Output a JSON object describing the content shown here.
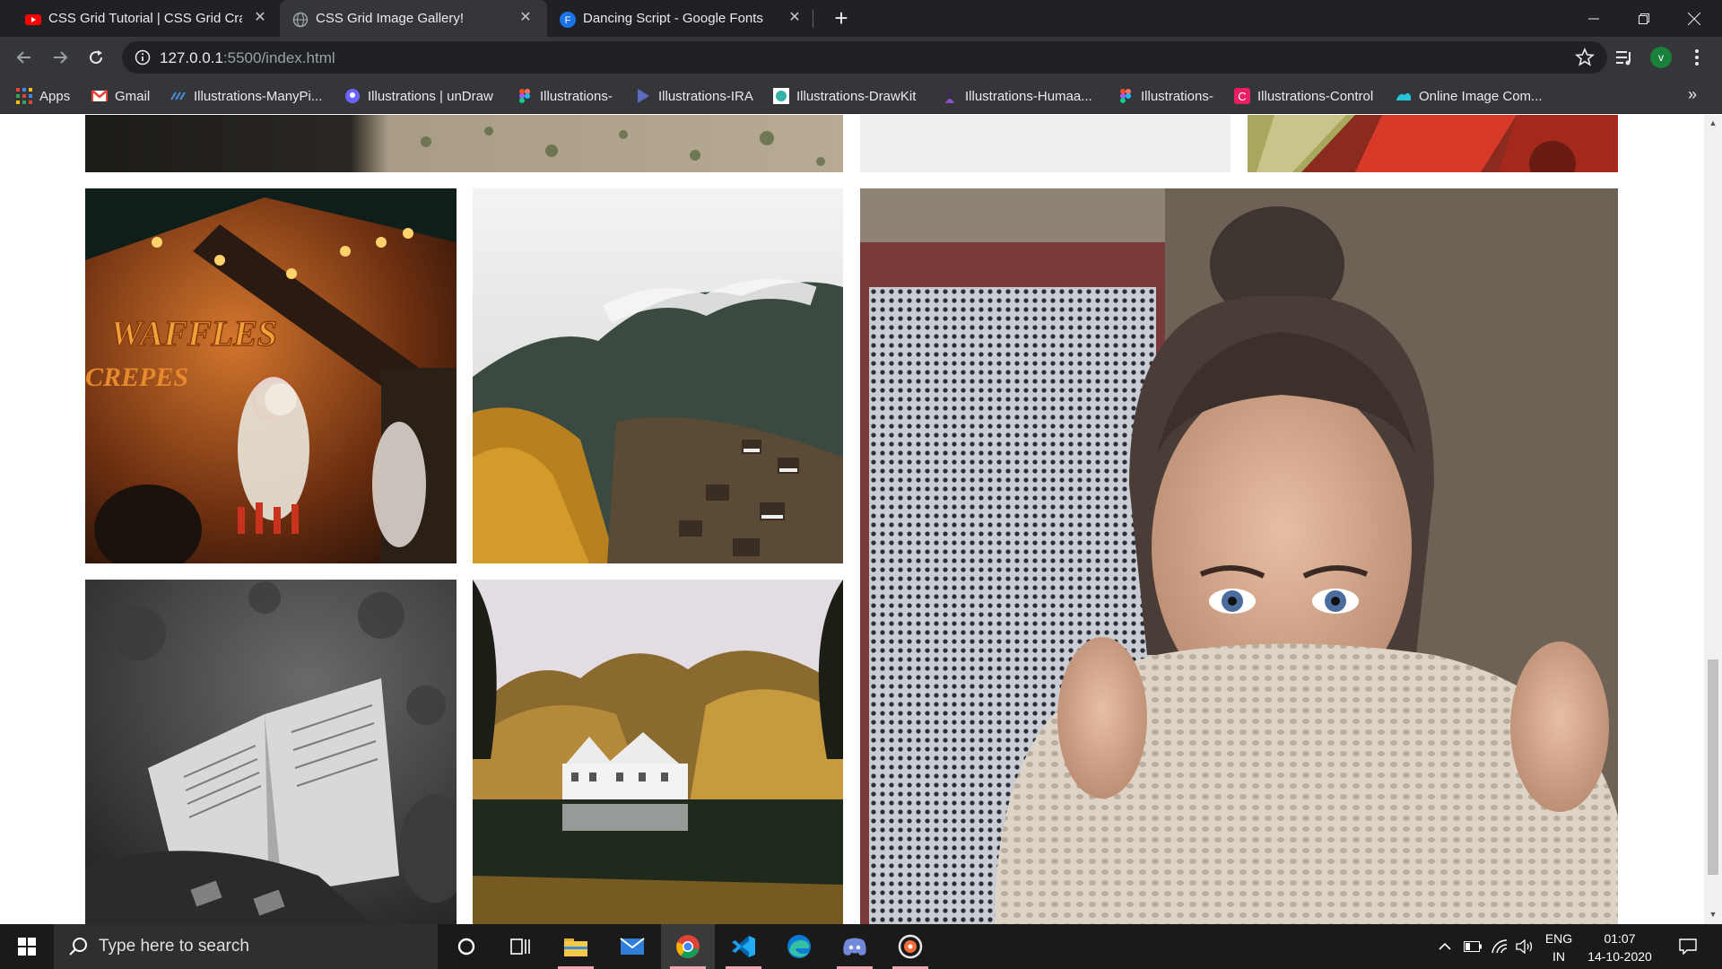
{
  "browser": {
    "tabs": [
      {
        "title": "CSS Grid Tutorial | CSS Grid Crash",
        "favicon": "youtube-icon",
        "active": false
      },
      {
        "title": "CSS Grid Image Gallery!",
        "favicon": "globe-icon",
        "active": true
      },
      {
        "title": "Dancing Script - Google Fonts",
        "favicon": "google-fonts-icon",
        "active": false
      }
    ],
    "address": {
      "host": "127.0.0.1",
      "path": ":5500/index.html"
    },
    "avatar_letter": "v",
    "bookmarks": [
      {
        "label": "Apps",
        "icon": "apps-grid-icon"
      },
      {
        "label": "Gmail",
        "icon": "gmail-icon"
      },
      {
        "label": "Illustrations-ManyPi...",
        "icon": "manypixels-icon"
      },
      {
        "label": "Illustrations | unDraw",
        "icon": "undraw-icon"
      },
      {
        "label": "Illustrations-",
        "icon": "figma-icon"
      },
      {
        "label": "Illustrations-IRA",
        "icon": "ira-icon"
      },
      {
        "label": "Illustrations-DrawKit",
        "icon": "drawkit-icon"
      },
      {
        "label": "Illustrations-Humaa...",
        "icon": "humaaans-icon"
      },
      {
        "label": "Illustrations-",
        "icon": "figma-icon"
      },
      {
        "label": "Illustrations-Control",
        "icon": "control-icon"
      },
      {
        "label": "Online Image Com...",
        "icon": "image-compress-icon"
      }
    ]
  },
  "gallery": {
    "images": [
      {
        "name": "desert-landscape",
        "description": "ground with shrubs"
      },
      {
        "name": "light-wall",
        "description": "pale grey surface"
      },
      {
        "name": "red-building",
        "description": "red geometric facade"
      },
      {
        "name": "waffle-stand",
        "description": "night market stall",
        "sign_text": "WAFFLES",
        "sub_sign_text": "CREPES"
      },
      {
        "name": "misty-mountain-village",
        "description": "foggy forest hillside"
      },
      {
        "name": "woman-sweater-portrait",
        "description": "woman covering face with knit sweater"
      },
      {
        "name": "reading-book",
        "description": "black and white open book"
      },
      {
        "name": "lake-house",
        "description": "white house by a lake in autumn"
      }
    ]
  },
  "taskbar": {
    "search_placeholder": "Type here to search",
    "apps": [
      "cortana-icon",
      "task-view-icon",
      "file-explorer-icon",
      "mail-icon",
      "chrome-icon",
      "vscode-icon",
      "edge-icon",
      "discord-icon",
      "media-icon"
    ],
    "language": "ENG",
    "region": "IN",
    "time": "01:07",
    "date": "14-10-2020"
  },
  "colors": {
    "tab_strip": "#202124",
    "toolbar": "#35363a",
    "taskbar": "#1a1a1a"
  }
}
